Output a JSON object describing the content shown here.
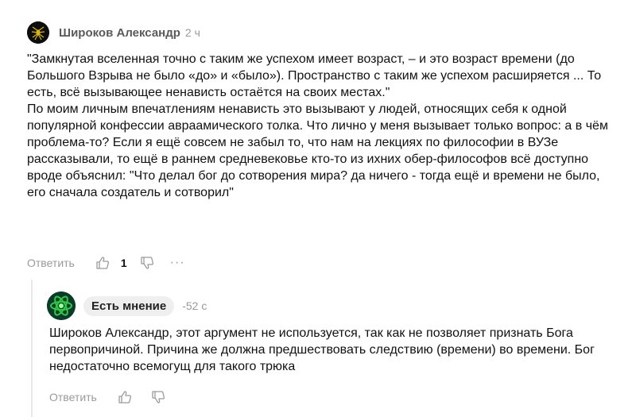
{
  "comment": {
    "author": "Широков Александр",
    "time": "2 ч",
    "paragraphs": [
      "\"Замкнутая вселенная точно с таким же успехом имеет возраст, – и это возраст времени (до Большого Взрыва не было «до» и «было»). Пространство с таким же успехом расширяется ... То есть, всё вызывающее ненависть остаётся на своих местах.\"",
      "По моим личным впечатлениям ненависть это вызывают у людей, относящих себя к одной популярной конфессии авраамического толка. Что лично у меня вызывает только вопрос: а в чём проблема-то? Если я ещё совсем не забыл то, что нам на лекциях по философии в ВУЗе рассказывали, то ещё в раннем средневековье кто-то из ихних обер-философов всё доступно вроде объяснил: \"Что делал бог до сотворения мира? да ничего - тогда ещё и времени не было, его сначала создатель и сотворил\""
    ],
    "reply_label": "Ответить",
    "like_count": "1",
    "more_label": "···",
    "avatar_icon": "spider-icon"
  },
  "reply": {
    "author": "Есть мнение",
    "time": "-52 с",
    "text": "Широков Александр, этот аргумент не используется, так как не позволяет признать Бога первопричиной. Причина же должна предшествовать следствию (времени) во времени. Бог недостаточно всемогущ для такого трюка",
    "reply_label": "Ответить",
    "avatar_icon": "atom-icon"
  },
  "colors": {
    "muted": "#9a9a9a",
    "badge_bg": "#efefef",
    "atom_green": "#2ecc40"
  }
}
